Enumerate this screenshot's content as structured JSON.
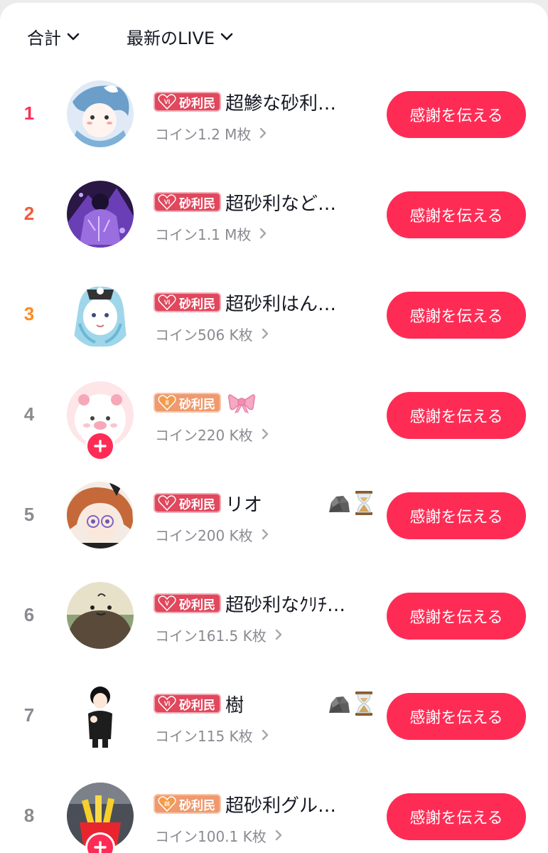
{
  "filters": {
    "period": "合計",
    "source": "最新のLIVE"
  },
  "badge_label": "砂利民",
  "thank_label": "感謝を伝える",
  "colors": {
    "accent": "#fe2c55",
    "rank1": "#fe2c55",
    "rank2": "#f25a3a",
    "rank3": "#ff8a1c",
    "rank_default": "#8a8b91",
    "badge_red": "#e0485d",
    "badge_orange": "#ee9a6e"
  },
  "rows": [
    {
      "rank": "1",
      "name": "超鯵な砂利…",
      "coins": "コイン1.2 M枚",
      "badge_level": "VI",
      "avatar": "blue-hair-avatar",
      "emojis": [],
      "follow": false
    },
    {
      "rank": "2",
      "name": "超砂利など…",
      "coins": "コイン1.1 M枚",
      "badge_level": "VI",
      "avatar": "purple-warrior-avatar",
      "emojis": [],
      "follow": false
    },
    {
      "rank": "3",
      "name": "超砂利はん…",
      "coins": "コイン506 K枚",
      "badge_level": "VI",
      "avatar": "maid-headband-avatar",
      "emojis": [],
      "follow": false
    },
    {
      "rank": "4",
      "name": "",
      "coins": "コイン220 K枚",
      "badge_level": "II",
      "avatar": "pink-pig-avatar",
      "emojis": [
        "ribbon-emoji"
      ],
      "follow": true
    },
    {
      "rank": "5",
      "name": "リオ",
      "coins": "コイン200 K枚",
      "badge_level": "V",
      "avatar": "glasses-anime-avatar",
      "emojis": [
        "rock-emoji",
        "hourglass-emoji"
      ],
      "follow": false
    },
    {
      "rank": "6",
      "name": "超砂利なｸﾘﾁ…",
      "coins": "コイン161.5 K枚",
      "badge_level": "V",
      "avatar": "green-creature-avatar",
      "emojis": [],
      "follow": false
    },
    {
      "rank": "7",
      "name": "樹",
      "coins": "コイン115 K枚",
      "badge_level": "VI",
      "avatar": "black-suit-avatar",
      "emojis": [
        "rock-emoji",
        "hourglass-emoji"
      ],
      "follow": false
    },
    {
      "rank": "8",
      "name": "超砂利グル…",
      "coins": "コイン100.1 K枚",
      "badge_level": "III",
      "avatar": "fries-avatar",
      "emojis": [],
      "follow": true
    }
  ]
}
